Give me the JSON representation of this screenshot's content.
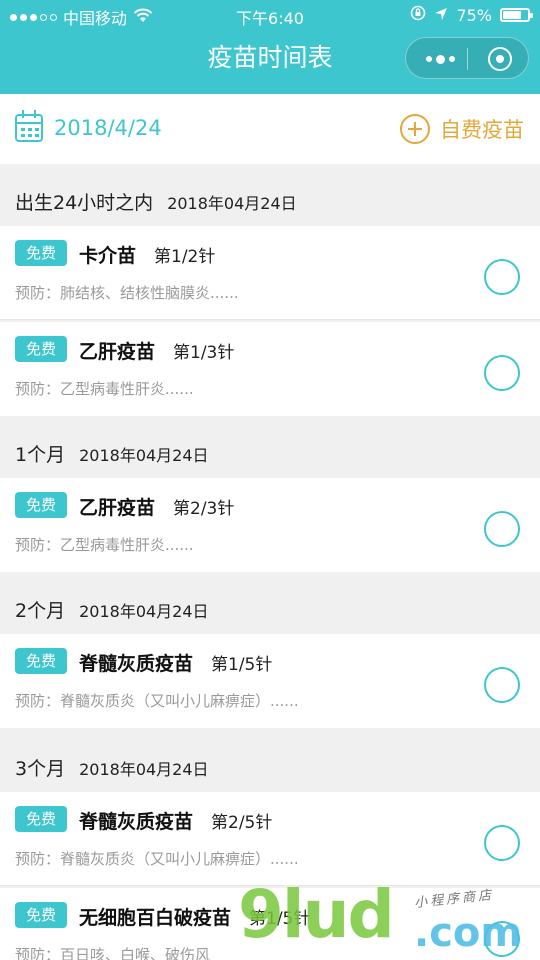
{
  "status": {
    "carrier": "中国移动",
    "time": "下午6:40",
    "battery_text": "75%",
    "battery_level": 0.75
  },
  "nav": {
    "title": "疫苗时间表"
  },
  "date_row": {
    "date": "2018/4/24",
    "self_pay_label": "自费疫苗"
  },
  "sections": [
    {
      "age": "出生24小时之内",
      "date": "2018年04月24日",
      "items": [
        {
          "badge": "免费",
          "name": "卡介苗",
          "dose": "第1/2针",
          "prevent": "预防：肺结核、结核性脑膜炎......"
        },
        {
          "badge": "免费",
          "name": "乙肝疫苗",
          "dose": "第1/3针",
          "prevent": "预防：乙型病毒性肝炎......"
        }
      ]
    },
    {
      "age": "1个月",
      "date": "2018年04月24日",
      "items": [
        {
          "badge": "免费",
          "name": "乙肝疫苗",
          "dose": "第2/3针",
          "prevent": "预防：乙型病毒性肝炎......"
        }
      ]
    },
    {
      "age": "2个月",
      "date": "2018年04月24日",
      "items": [
        {
          "badge": "免费",
          "name": "脊髓灰质疫苗",
          "dose": "第1/5针",
          "prevent": "预防：脊髓灰质炎（又叫小儿麻痹症）......"
        }
      ]
    },
    {
      "age": "3个月",
      "date": "2018年04月24日",
      "items": [
        {
          "badge": "免费",
          "name": "脊髓灰质疫苗",
          "dose": "第2/5针",
          "prevent": "预防：脊髓灰质炎（又叫小儿麻痹症）......"
        },
        {
          "badge": "免费",
          "name": "无细胞百白破疫苗",
          "dose": "第1/5针",
          "prevent": "预防：百日咳、白喉、破伤风"
        }
      ]
    }
  ],
  "watermark": {
    "brand": "9lud",
    "domain": ".com",
    "tagline": "小程序商店"
  },
  "colors": {
    "accent": "#3ec6cf",
    "self_pay": "#e2a93a"
  }
}
